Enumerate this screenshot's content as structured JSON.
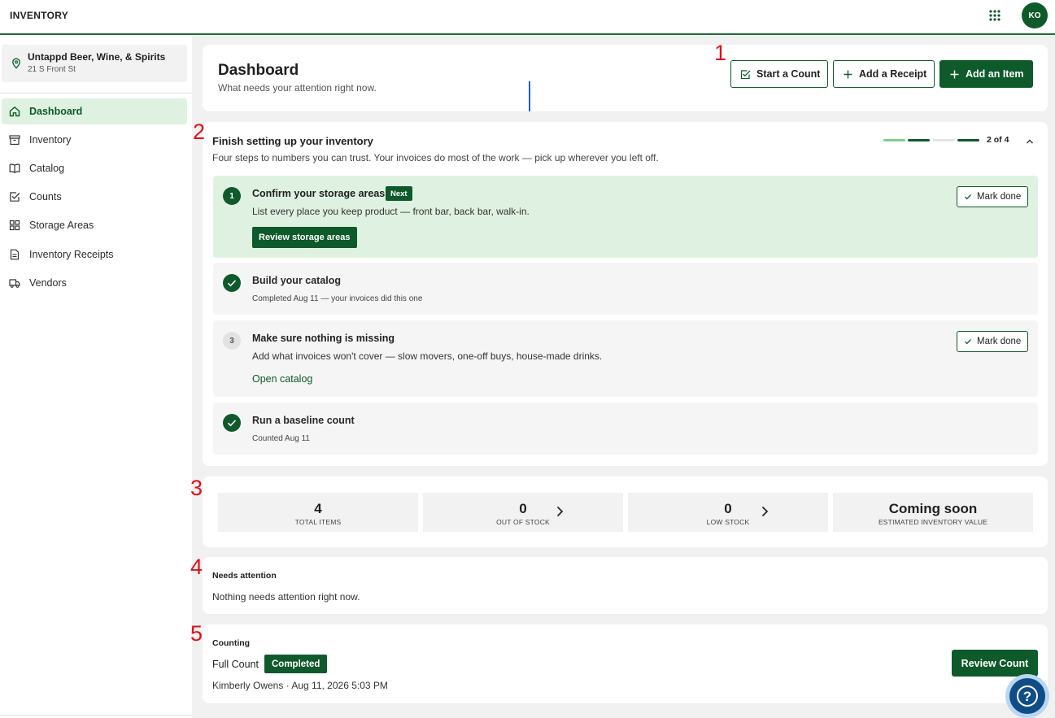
{
  "app": {
    "title": "INVENTORY",
    "user_initials": "KO"
  },
  "location": {
    "name": "Untappd Beer, Wine, & Spirits",
    "address": "21 S Front St"
  },
  "sidebar": {
    "items": [
      {
        "label": "Dashboard",
        "icon": "home-icon",
        "active": true
      },
      {
        "label": "Inventory",
        "icon": "archive-box-icon"
      },
      {
        "label": "Catalog",
        "icon": "book-icon"
      },
      {
        "label": "Counts",
        "icon": "checkbox-icon"
      },
      {
        "label": "Storage Areas",
        "icon": "grid-icon"
      },
      {
        "label": "Inventory Receipts",
        "icon": "document-icon"
      },
      {
        "label": "Vendors",
        "icon": "truck-icon"
      }
    ]
  },
  "header": {
    "title": "Dashboard",
    "subtitle": "What needs your attention right now.",
    "start_count": "Start a Count",
    "add_receipt": "Add a Receipt",
    "add_item": "Add an Item"
  },
  "setup": {
    "title": "Finish setting up your inventory",
    "subtitle": "Four steps to numbers you can trust. Your invoices do most of the work — pick up wherever you left off.",
    "progress_label": "2 of 4",
    "steps_done": [
      false,
      true,
      false,
      true
    ],
    "steps": [
      {
        "number": "1",
        "title": "Confirm your storage areas",
        "badge": "Next",
        "description": "List every place you keep product — front bar, back bar, walk-in.",
        "action": "Review storage areas",
        "mark_done": "Mark done"
      },
      {
        "title": "Build your catalog",
        "description": "Completed Aug 11 — your invoices did this one"
      },
      {
        "number": "3",
        "title": "Make sure nothing is missing",
        "description": "Add what invoices won't cover — slow movers, one-off buys, house-made drinks.",
        "action": "Open catalog",
        "mark_done": "Mark done"
      },
      {
        "title": "Run a baseline count",
        "description": "Counted Aug 11"
      }
    ]
  },
  "stats": [
    {
      "value": "4",
      "label": "TOTAL ITEMS"
    },
    {
      "value": "0",
      "label": "OUT OF STOCK"
    },
    {
      "value": "0",
      "label": "LOW STOCK"
    },
    {
      "value": "Coming soon",
      "label": "ESTIMATED INVENTORY VALUE"
    }
  ],
  "attention": {
    "title": "Needs attention",
    "text": "Nothing needs attention right now."
  },
  "counting": {
    "title": "Counting",
    "count_name": "Full Count",
    "status": "Completed",
    "meta": "Kimberly Owens · Aug 11, 2026 5:03 PM",
    "review": "Review Count"
  },
  "annotations": [
    "1",
    "2",
    "3",
    "4",
    "5"
  ],
  "help": {
    "symbol": "?"
  },
  "colors": {
    "brand": "#0e5a2a",
    "accent_light": "#dff2e1",
    "annotation": "#e0121a"
  }
}
